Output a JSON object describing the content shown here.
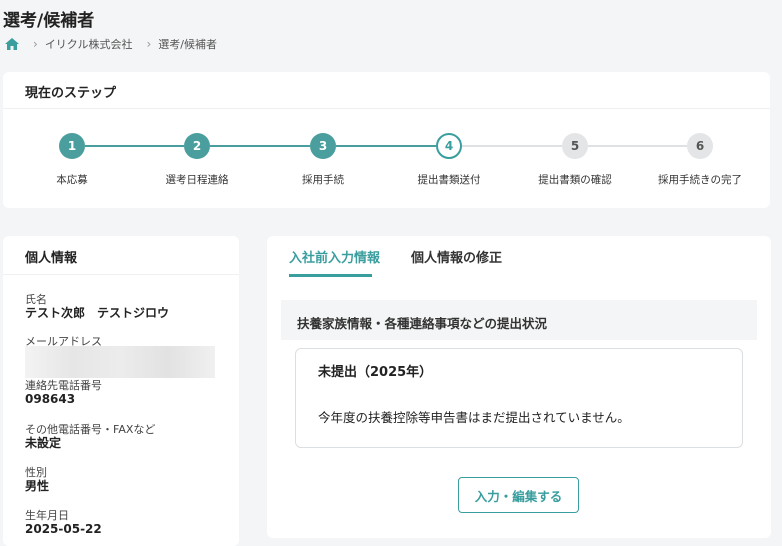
{
  "page_title": "選考/候補者",
  "breadcrumb": {
    "home_icon": "home-icon",
    "items": [
      "イリクル株式会社",
      "選考/候補者"
    ]
  },
  "steps_card": {
    "title": "現在のステップ",
    "current_step": 4,
    "colors": {
      "done": "#4a9e9e",
      "current_border": "#3a9e9e",
      "pending": "#e3e5e6",
      "line_done": "#4a9e9e",
      "line_pending": "#dfe2e4"
    },
    "steps": [
      {
        "number": "1",
        "label": "本応募",
        "state": "done"
      },
      {
        "number": "2",
        "label": "選考日程連絡",
        "state": "done"
      },
      {
        "number": "3",
        "label": "採用手続",
        "state": "done"
      },
      {
        "number": "4",
        "label": "提出書類送付",
        "state": "current"
      },
      {
        "number": "5",
        "label": "提出書類の確認",
        "state": "pending"
      },
      {
        "number": "6",
        "label": "採用手続きの完了",
        "state": "pending"
      }
    ]
  },
  "personal_info": {
    "title": "個人情報",
    "fields": [
      {
        "label": "氏名",
        "value": "テスト次郎　テストジロウ"
      },
      {
        "label": "メールアドレス",
        "value": ""
      },
      {
        "label": "連絡先電話番号",
        "value": "098643"
      },
      {
        "label": "その他電話番号・FAXなど",
        "value": "未設定"
      },
      {
        "label": "性別",
        "value": "男性"
      },
      {
        "label": "生年月日",
        "value": "2025-05-22"
      }
    ]
  },
  "main": {
    "tabs": [
      {
        "label": "入社前入力情報",
        "active": true
      },
      {
        "label": "個人情報の修正",
        "active": false
      }
    ],
    "section_header": "扶養家族情報・各種連絡事項などの提出状況",
    "status": {
      "title": "未提出（2025年）",
      "message": "今年度の扶養控除等申告書はまだ提出されていません。"
    },
    "edit_button_label": "入力・編集する"
  }
}
